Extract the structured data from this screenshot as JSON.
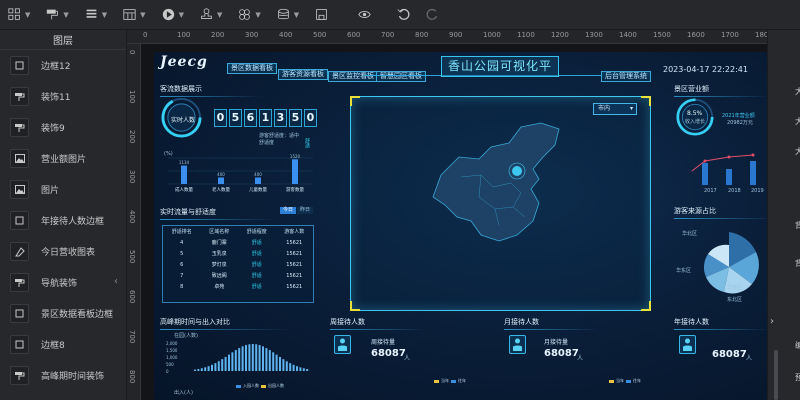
{
  "toolbar": {
    "items": [
      {
        "icon": "grid-icon"
      },
      {
        "icon": "paint-roller-icon"
      },
      {
        "icon": "list-icon"
      },
      {
        "icon": "table-icon"
      },
      {
        "icon": "play-icon"
      },
      {
        "icon": "stamp-icon"
      },
      {
        "icon": "link-icon"
      },
      {
        "icon": "layers-icon"
      },
      {
        "icon": "save-icon"
      },
      {
        "icon": "eye-icon"
      },
      {
        "icon": "undo-icon"
      },
      {
        "icon": "redo-icon"
      }
    ]
  },
  "sidebar": {
    "title": "图层",
    "items": [
      {
        "label": "边框12",
        "icon": "border-icon"
      },
      {
        "label": "装饰11",
        "icon": "decoration-icon"
      },
      {
        "label": "装饰9",
        "icon": "decoration-icon"
      },
      {
        "label": "营业额图片",
        "icon": "image-icon"
      },
      {
        "label": "图片",
        "icon": "image-icon"
      },
      {
        "label": "年接待人数边框",
        "icon": "border-icon"
      },
      {
        "label": "今日营收图表",
        "icon": "chart-icon"
      },
      {
        "label": "导航装饰",
        "icon": "decoration-icon"
      },
      {
        "label": "景区数据看板边框",
        "icon": "border-icon"
      },
      {
        "label": "边框8",
        "icon": "border-icon"
      },
      {
        "label": "高峰期时间装饰",
        "icon": "decoration-icon"
      }
    ]
  },
  "ruler": {
    "top": [
      "0",
      "100",
      "200",
      "300",
      "400",
      "500",
      "600",
      "700",
      "800",
      "900",
      "1000",
      "1100",
      "1200",
      "1300",
      "1400",
      "1500",
      "1600",
      "1700",
      "1800"
    ],
    "left": [
      "0",
      "100",
      "200",
      "300",
      "400",
      "500",
      "600",
      "700",
      "800"
    ]
  },
  "right_panel": {
    "labels": [
      "大",
      "大",
      "大",
      "背",
      "背",
      "编",
      "预"
    ]
  },
  "dashboard": {
    "logo": "Jeecg",
    "nav": [
      "景区数据看板",
      "游客资源看板",
      "景区监控看板",
      "智慧园区看板",
      "后台管理系统"
    ],
    "title": "香山公园可视化平",
    "date": "2023-04-17 22:22:41",
    "left": {
      "section1": "客流数据展示",
      "gauge_label": "实时人数",
      "digits": [
        "0",
        "5",
        "6",
        "1",
        "3",
        "5",
        "0"
      ],
      "comfort": "游客舒适度：适中",
      "comfort2": "舒适度",
      "comfort_value": "舒适",
      "bar_unit": "(%)",
      "bars": {
        "categories": [
          "成人数量",
          "老人数量",
          "儿童数量",
          "游客数量"
        ],
        "values": [
          1134,
          400,
          400,
          1520
        ]
      },
      "section2": "实时流量与舒适度",
      "toggle": [
        "今日",
        "昨日"
      ],
      "table_headers": [
        "舒适排名",
        "区域名称",
        "舒适程度",
        "游客人数"
      ],
      "table_rows": [
        [
          "4",
          "鹿门寨",
          "舒适",
          "15621"
        ],
        [
          "5",
          "玉乳泉",
          "舒适",
          "15621"
        ],
        [
          "6",
          "梦灯泉",
          "舒适",
          "15621"
        ],
        [
          "7",
          "致远阁",
          "舒适",
          "15621"
        ],
        [
          "8",
          "卓苑",
          "舒适",
          "15621"
        ]
      ],
      "section3": "高峰期时间与出入对比",
      "chart_unit": "在园(人数)",
      "y_ticks": [
        "2,000",
        "1,500",
        "1,000",
        "500",
        "0"
      ],
      "legend": [
        "入园人数",
        "出园人数"
      ],
      "chart2_unit": "出入(人)"
    },
    "map": {
      "city_select": "市内"
    },
    "right": {
      "section1": "景区营业额",
      "gauge_pct": "8.5%",
      "gauge_label": "收入增长",
      "year_label": "2021年营业额",
      "year_value": "20982万元",
      "chart_years": [
        "2017",
        "2018",
        "2019"
      ],
      "section2": "游客来源占比",
      "pie_labels": [
        "华北区",
        "华东区",
        "华南区",
        "东北区",
        "西北区",
        "西南区"
      ],
      "section3": "年接待人数",
      "value3": "68087",
      "unit3": "人"
    },
    "bottom": {
      "weekly": {
        "section": "周接待人数",
        "label": "周接待量",
        "value": "68087",
        "unit": "人"
      },
      "monthly": {
        "section": "月接待人数",
        "label": "月接待量",
        "value": "68087",
        "unit": "人"
      },
      "legend": [
        "当年",
        "往年"
      ]
    }
  },
  "chart_data": {
    "type": "bar",
    "categories": [
      "成人数量",
      "老人数量",
      "儿童数量",
      "游客数量"
    ],
    "values": [
      1134,
      400,
      400,
      1520
    ],
    "ylabel": "(%)"
  }
}
